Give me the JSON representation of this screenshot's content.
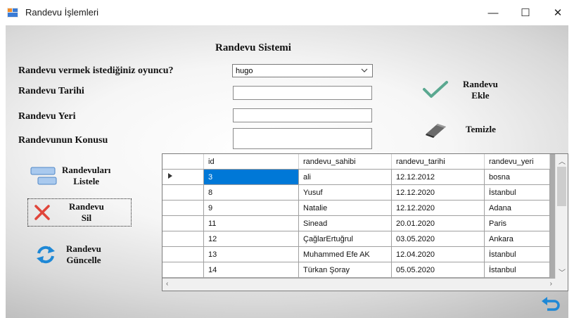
{
  "window": {
    "title": "Randevu İşlemleri",
    "minimize_glyph": "—",
    "maximize_glyph": "☐",
    "close_glyph": "✕"
  },
  "form": {
    "heading": "Randevu Sistemi",
    "player_label": "Randevu vermek istediğiniz oyuncu?",
    "player_value": "hugo",
    "date_label": "Randevu Tarihi",
    "place_label": "Randevu Yeri",
    "subject_label": "Randevunun Konusu"
  },
  "actions": {
    "add_line1": "Randevu",
    "add_line2": "Ekle",
    "clear": "Temizle",
    "list_line1": "Randevuları",
    "list_line2": "Listele",
    "delete_line1": "Randevu",
    "delete_line2": "Sil",
    "update_line1": "Randevu",
    "update_line2": "Güncelle"
  },
  "grid": {
    "columns": [
      "id",
      "randevu_sahibi",
      "randevu_tarihi",
      "randevu_yeri"
    ],
    "rows": [
      [
        "3",
        "ali",
        "12.12.2012",
        "bosna"
      ],
      [
        "8",
        "Yusuf",
        "12.12.2020",
        "İstanbul"
      ],
      [
        "9",
        "Natalie",
        "12.12.2020",
        "Adana"
      ],
      [
        "11",
        "Sinead",
        "20.01.2020",
        "Paris"
      ],
      [
        "12",
        "ÇağlarErtuğrul",
        "03.05.2020",
        "Ankara"
      ],
      [
        "13",
        "Muhammed Efe AK",
        "12.04.2020",
        "İstanbul"
      ],
      [
        "14",
        "Türkan Şoray",
        "05.05.2020",
        "İstanbul"
      ]
    ],
    "selected_row": 0
  },
  "colors": {
    "selection": "#0078d7",
    "check_green": "#5aa890",
    "delete_red": "#e0453a",
    "refresh_blue": "#1e88d6"
  }
}
